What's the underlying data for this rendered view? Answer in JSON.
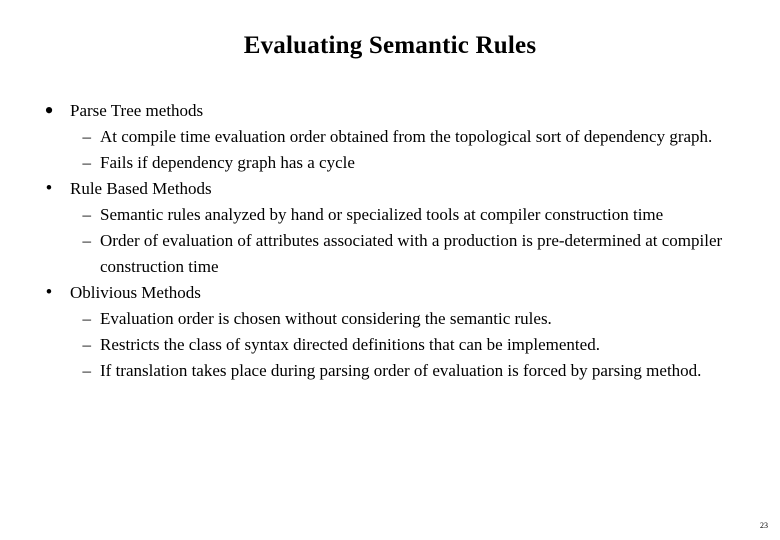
{
  "slide": {
    "title": "Evaluating Semantic Rules",
    "page_number": "23",
    "bullets": [
      {
        "marker": "•",
        "text": "Parse Tree methods",
        "sub": [
          {
            "marker": "–",
            "text": "At compile time evaluation order obtained from the topological sort of dependency graph."
          },
          {
            "marker": "–",
            "text": "Fails if dependency graph has a cycle"
          }
        ]
      },
      {
        "marker": "•",
        "text": "Rule Based Methods",
        "sub": [
          {
            "marker": "–",
            "text": "Semantic rules analyzed  by hand or specialized tools at compiler construction time"
          },
          {
            "marker": "–",
            "text": "Order of evaluation of attributes associated with a production is pre-determined at compiler construction time"
          }
        ]
      },
      {
        "marker": "•",
        "text": "Oblivious Methods",
        "sub": [
          {
            "marker": "–",
            "text": "Evaluation order is chosen without considering the semantic rules."
          },
          {
            "marker": "–",
            "text": "Restricts the class of syntax directed definitions  that can be implemented."
          },
          {
            "marker": "–",
            "text": "If translation takes place during parsing order of evaluation is forced  by parsing method."
          }
        ]
      }
    ]
  }
}
